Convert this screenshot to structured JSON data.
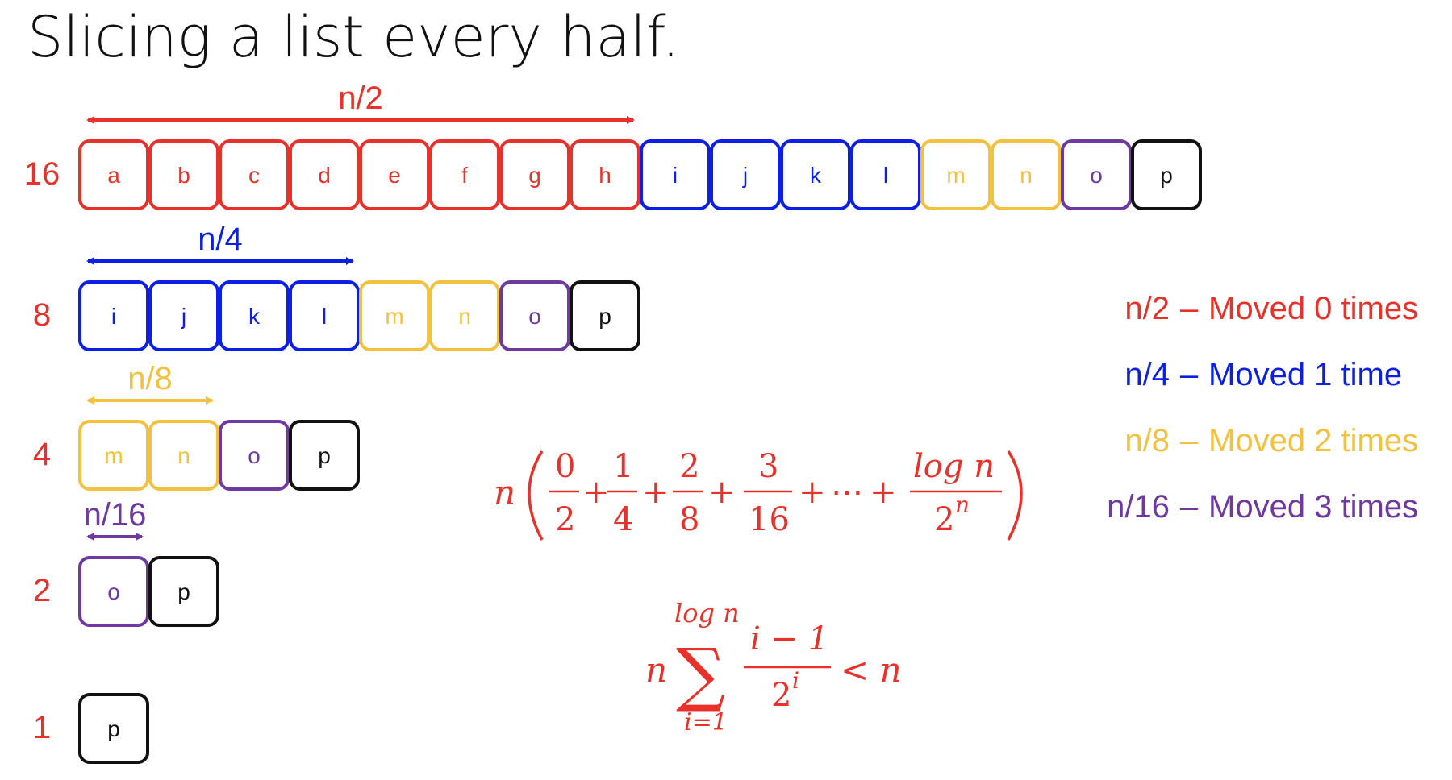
{
  "title": "Slicing a list every half.",
  "colors": {
    "red": "#e8312a",
    "blue": "#0c1fe3",
    "yellow": "#f2c13f",
    "purple": "#6f3aa0",
    "black": "#111111"
  },
  "rows": [
    {
      "count_label": "16",
      "span": {
        "label": "n/2",
        "cells": 8,
        "color": "red"
      },
      "cells": [
        {
          "letter": "a",
          "color": "red"
        },
        {
          "letter": "b",
          "color": "red"
        },
        {
          "letter": "c",
          "color": "red"
        },
        {
          "letter": "d",
          "color": "red"
        },
        {
          "letter": "e",
          "color": "red"
        },
        {
          "letter": "f",
          "color": "red"
        },
        {
          "letter": "g",
          "color": "red"
        },
        {
          "letter": "h",
          "color": "red"
        },
        {
          "letter": "i",
          "color": "blue"
        },
        {
          "letter": "j",
          "color": "blue"
        },
        {
          "letter": "k",
          "color": "blue"
        },
        {
          "letter": "l",
          "color": "blue"
        },
        {
          "letter": "m",
          "color": "yellow"
        },
        {
          "letter": "n",
          "color": "yellow"
        },
        {
          "letter": "o",
          "color": "purple"
        },
        {
          "letter": "p",
          "color": "black"
        }
      ]
    },
    {
      "count_label": "8",
      "span": {
        "label": "n/4",
        "cells": 4,
        "color": "blue"
      },
      "cells": [
        {
          "letter": "i",
          "color": "blue"
        },
        {
          "letter": "j",
          "color": "blue"
        },
        {
          "letter": "k",
          "color": "blue"
        },
        {
          "letter": "l",
          "color": "blue"
        },
        {
          "letter": "m",
          "color": "yellow"
        },
        {
          "letter": "n",
          "color": "yellow"
        },
        {
          "letter": "o",
          "color": "purple"
        },
        {
          "letter": "p",
          "color": "black"
        }
      ]
    },
    {
      "count_label": "4",
      "span": {
        "label": "n/8",
        "cells": 2,
        "color": "yellow"
      },
      "cells": [
        {
          "letter": "m",
          "color": "yellow"
        },
        {
          "letter": "n",
          "color": "yellow"
        },
        {
          "letter": "o",
          "color": "purple"
        },
        {
          "letter": "p",
          "color": "black"
        }
      ]
    },
    {
      "count_label": "2",
      "span": {
        "label": "n/16",
        "cells": 1,
        "color": "purple"
      },
      "cells": [
        {
          "letter": "o",
          "color": "purple"
        },
        {
          "letter": "p",
          "color": "black"
        }
      ]
    },
    {
      "count_label": "1",
      "span": null,
      "cells": [
        {
          "letter": "p",
          "color": "black"
        }
      ]
    }
  ],
  "legend": [
    {
      "label": "n/2",
      "separator": "–",
      "text": "Moved 0 times",
      "color": "red"
    },
    {
      "label": "n/4",
      "separator": "–",
      "text": "Moved 1 time",
      "color": "blue"
    },
    {
      "label": "n/8",
      "separator": "–",
      "text": "Moved 2 times",
      "color": "yellow"
    },
    {
      "label": "n/16",
      "separator": "–",
      "text": "Moved 3 times",
      "color": "purple"
    }
  ],
  "formula_sum": {
    "prefix": "n",
    "fractions": [
      {
        "num": "0",
        "den": "2"
      },
      {
        "num": "1",
        "den": "4"
      },
      {
        "num": "2",
        "den": "8"
      },
      {
        "num": "3",
        "den": "16"
      }
    ],
    "plus": "+",
    "ellipsis": "⋯",
    "last": {
      "num": "log n",
      "den_base": "2",
      "den_exp": "n"
    }
  },
  "formula_bound": {
    "prefix": "n",
    "sigma": "∑",
    "upper": "log n",
    "lower": "i=1",
    "num": "i − 1",
    "den_base": "2",
    "den_exp": "i",
    "relation": "< n"
  }
}
